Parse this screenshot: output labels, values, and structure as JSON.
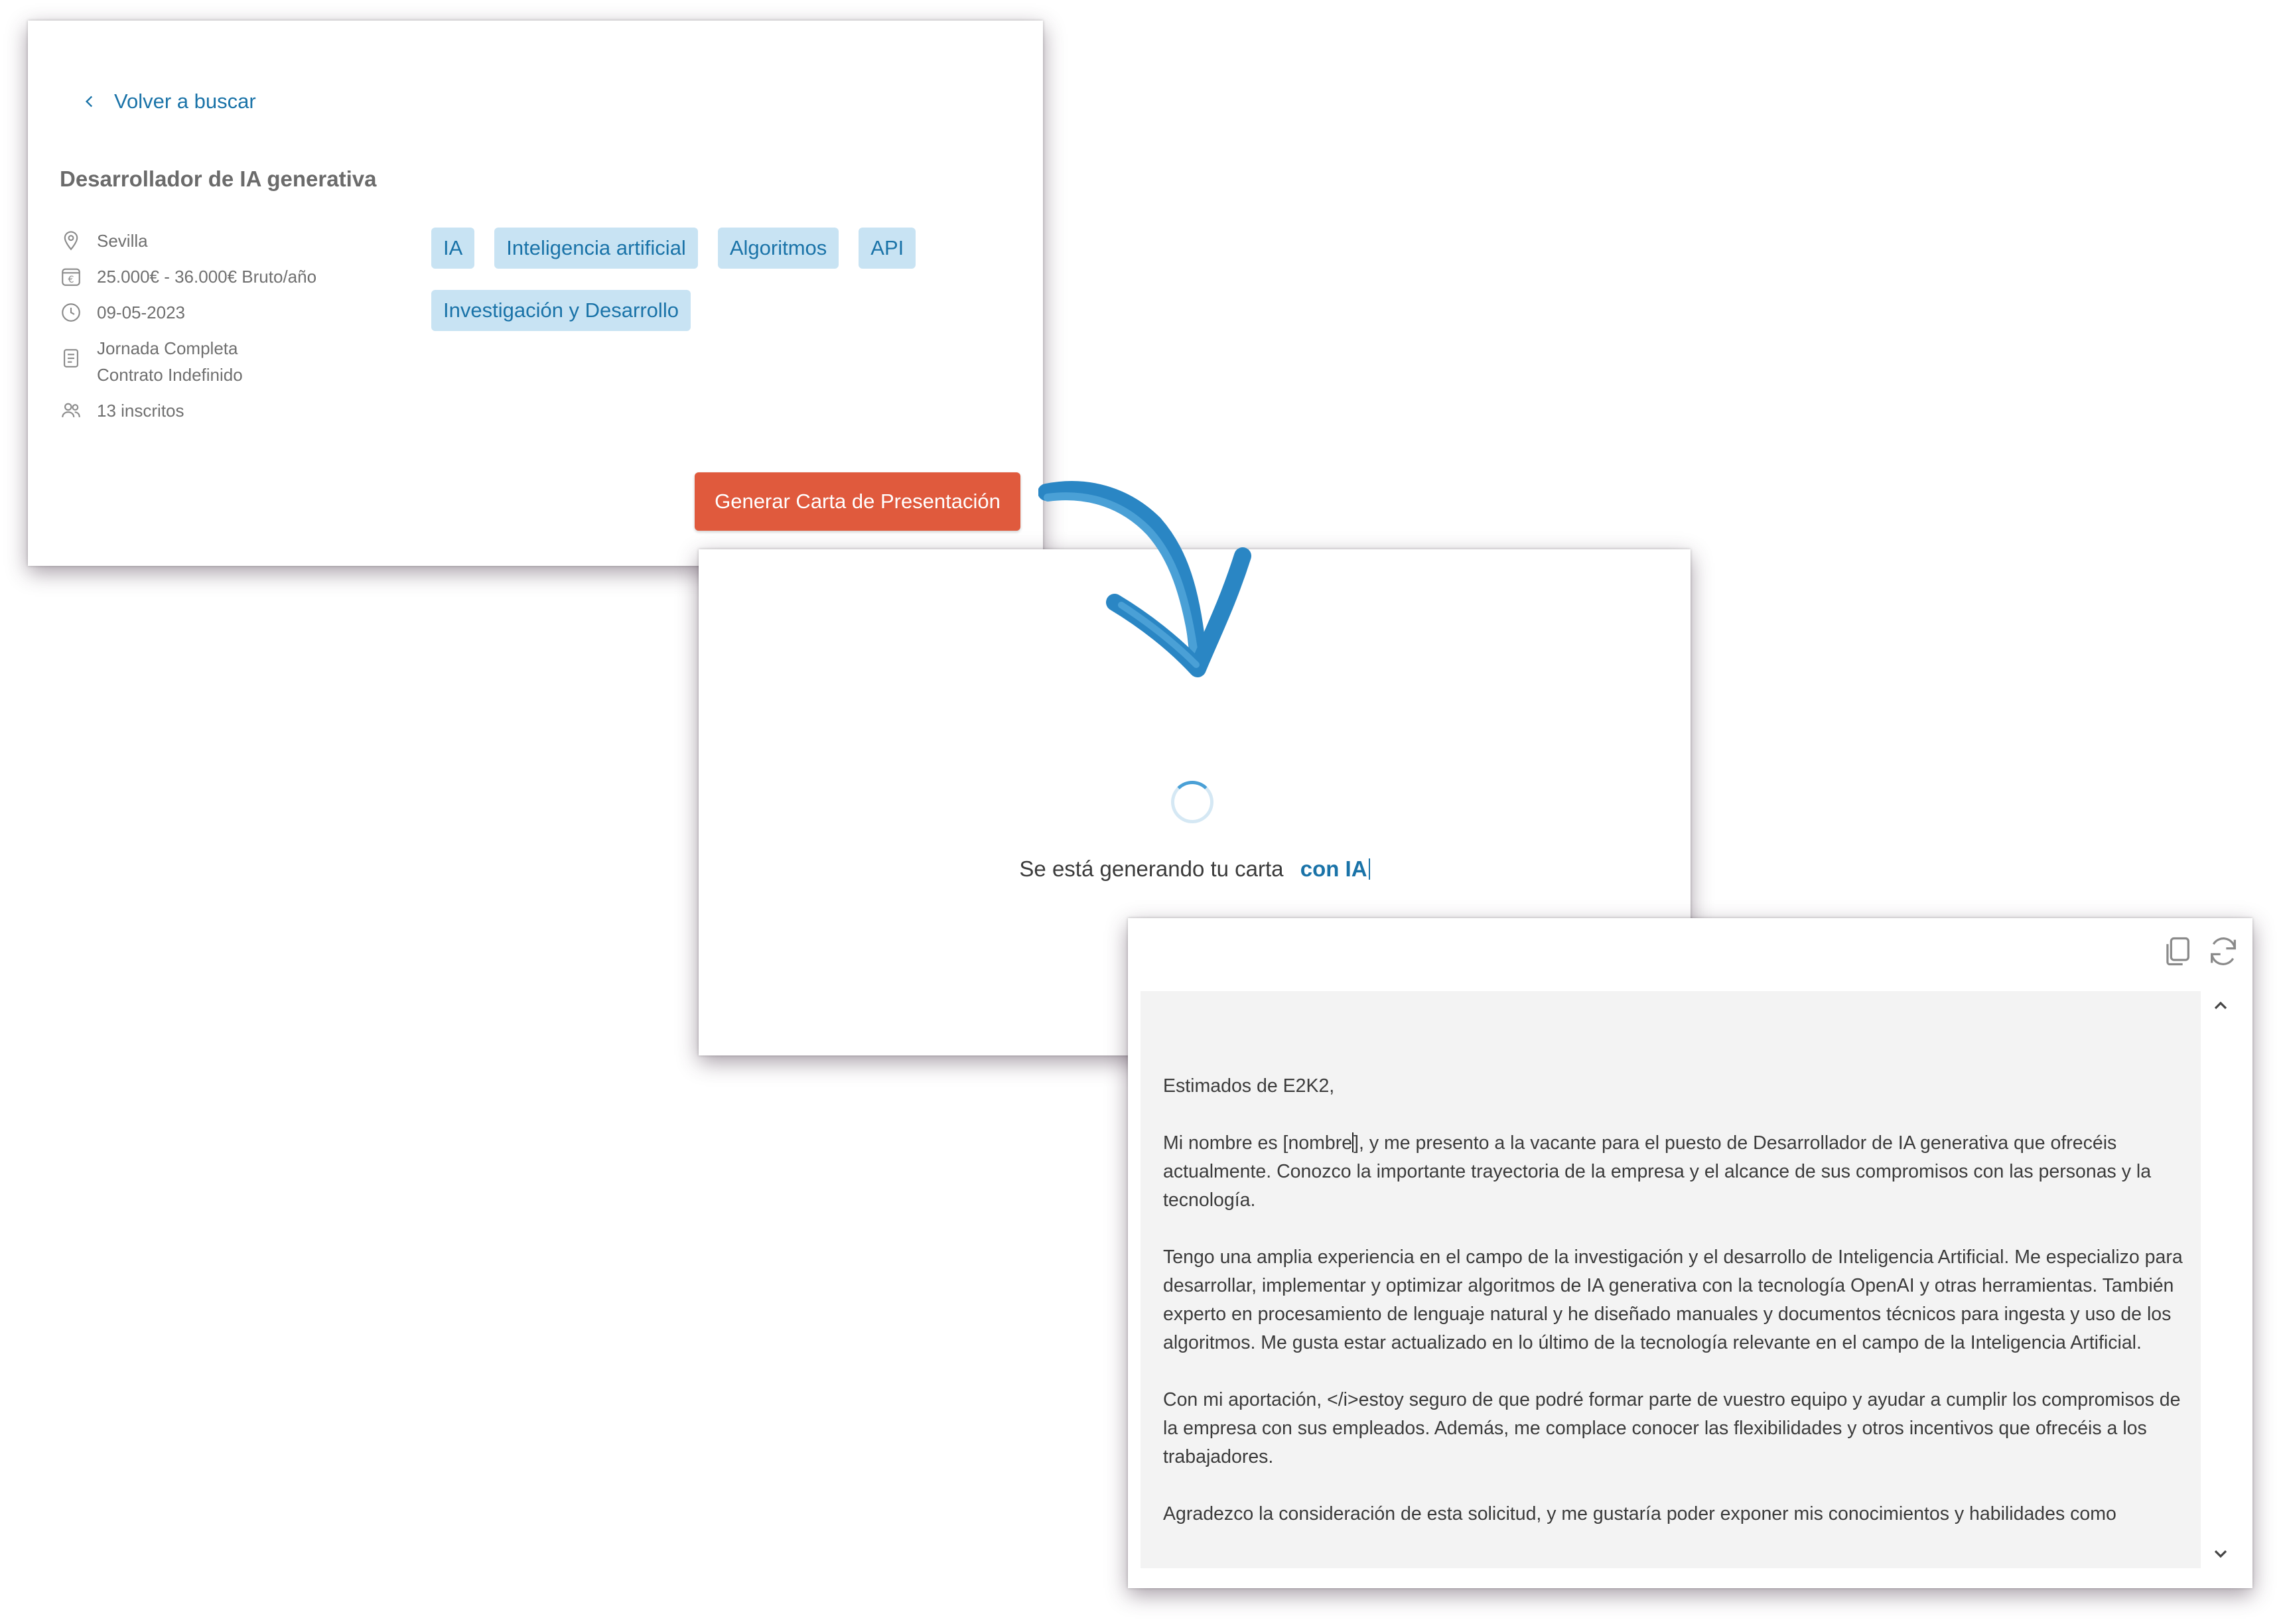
{
  "job_card": {
    "back_link": "Volver a buscar",
    "title": "Desarrollador de IA generativa",
    "location": "Sevilla",
    "salary": "25.000€ - 36.000€ Bruto/año",
    "date": "09-05-2023",
    "workday": "Jornada Completa",
    "contract": "Contrato Indefinido",
    "applicants": "13 inscritos",
    "tags": [
      "IA",
      "Inteligencia artificial",
      "Algoritmos",
      "API",
      "Investigación y Desarrollo"
    ],
    "generate_button": "Generar Carta de Presentación"
  },
  "generating_card": {
    "message": "Se está generando tu carta",
    "highlight": "con IA"
  },
  "letter_card": {
    "greeting": "Estimados de E2K2,",
    "p1_pre": "Mi nombre es [nombre",
    "p1_post": "], y me presento a la vacante para el puesto de Desarrollador de IA generativa que ofrecéis actualmente. Conozco la importante trayectoria de la empresa y el alcance de sus compromisos con las personas y la tecnología.",
    "p2": "Tengo una amplia experiencia en el campo de la investigación y el desarrollo de Inteligencia Artificial. Me especializo para desarrollar, implementar y optimizar algoritmos de IA generativa con la tecnología OpenAI y otras herramientas. También experto en procesamiento de lenguaje natural y he diseñado manuales y documentos técnicos para ingesta y uso de los algoritmos. Me gusta estar actualizado en lo último de la tecnología relevante en el campo de la Inteligencia Artificial.",
    "p3": "Con mi aportación, </i>estoy seguro de que podré formar parte de vuestro equipo y ayudar a cumplir los compromisos de la empresa con sus empleados. Además, me complace conocer las flexibilidades y otros incentivos que ofrecéis a los trabajadores.",
    "p4": "Agradezco la consideración de esta solicitud, y me gustaría poder exponer mis conocimientos y habilidades como",
    "icons": [
      "copy-icon",
      "refresh-icon",
      "chevron-up-icon",
      "chevron-down-icon"
    ]
  },
  "colors": {
    "link_blue": "#1a73a8",
    "tag_bg": "#c8e3f3",
    "button_orange": "#e05a3d",
    "arrow_blue": "#2a86c4",
    "letter_bg": "#f3f3f3"
  }
}
